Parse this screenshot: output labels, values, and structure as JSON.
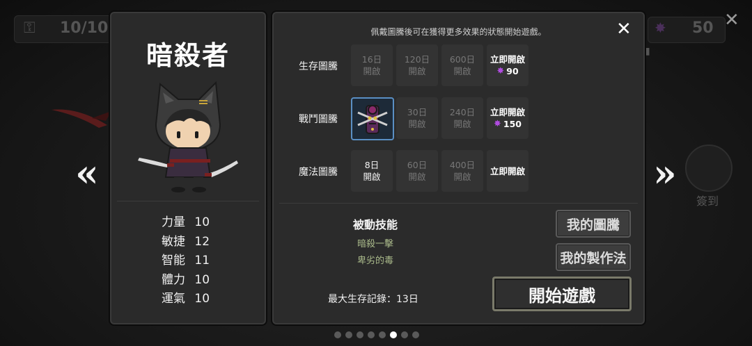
{
  "background": {
    "energy": "10/10",
    "gems": "50",
    "checkin_label": "簽到"
  },
  "character": {
    "name": "暗殺者",
    "stats": [
      {
        "name": "力量",
        "value": "10"
      },
      {
        "name": "敏捷",
        "value": "12"
      },
      {
        "name": "智能",
        "value": "11"
      },
      {
        "name": "體力",
        "value": "10"
      },
      {
        "name": "運氣",
        "value": "10"
      }
    ]
  },
  "totems": {
    "hint": "佩戴圖騰後可在獲得更多效果的狀態開始遊戲。",
    "rows": [
      {
        "label": "生存圖騰",
        "slots": [
          {
            "line1": "16日",
            "line2": "開啟"
          },
          {
            "line1": "120日",
            "line2": "開啟"
          },
          {
            "line1": "600日",
            "line2": "開啟"
          }
        ],
        "instant": {
          "label": "立即開啟",
          "price": "90"
        }
      },
      {
        "label": "戰鬥圖騰",
        "slots": [
          {
            "line1": "30日",
            "line2": "開啟"
          },
          {
            "line1": "240日",
            "line2": "開啟"
          }
        ],
        "instant": {
          "label": "立即開啟",
          "price": "150"
        }
      },
      {
        "label": "魔法圖騰",
        "slots": [
          {
            "line1": "8日",
            "line2": "開啟"
          },
          {
            "line1": "60日",
            "line2": "開啟"
          },
          {
            "line1": "400日",
            "line2": "開啟"
          }
        ],
        "instant": {
          "label": "立即開啟",
          "price": ""
        }
      }
    ]
  },
  "passive": {
    "title": "被動技能",
    "skills": [
      "暗殺一擊",
      "卑劣的毒"
    ]
  },
  "record": "最大生存記錄：13日",
  "buttons": {
    "my_totem": "我的圖騰",
    "my_recipe": "我的製作法",
    "start": "開始遊戲"
  },
  "colors": {
    "gem": "#b04ce0",
    "equipped_border": "#5a8fc4",
    "skill_text": "#a9b98a"
  },
  "pagination": {
    "total": 8,
    "active": 6
  }
}
